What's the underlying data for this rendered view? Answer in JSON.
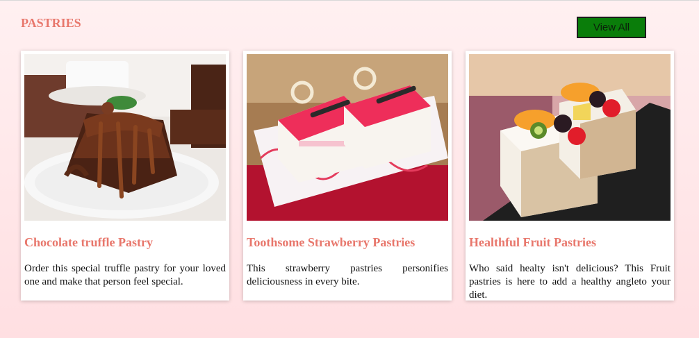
{
  "section": {
    "title": "PASTRIES"
  },
  "view_all": {
    "label": "View All"
  },
  "cards": [
    {
      "title": "Chocolate truffle Pastry",
      "description": "Order this special truffle pastry for your loved one and make that person feel special.",
      "image_icon": "chocolate-cake-image"
    },
    {
      "title": "Toothsome Strawberry Pastries",
      "description": "This strawberry pastries personifies deliciousness in every bite.",
      "image_icon": "strawberry-pastry-image"
    },
    {
      "title": "Healthful Fruit Pastries",
      "description": "Who said healty isn't delicious? This Fruit pastries is here to add a healthy angleto your diet.",
      "image_icon": "fruit-pastry-image"
    }
  ],
  "colors": {
    "accent": "#e8776c",
    "button_bg": "#0a7d0a",
    "page_bg": "#ffe6e8"
  }
}
